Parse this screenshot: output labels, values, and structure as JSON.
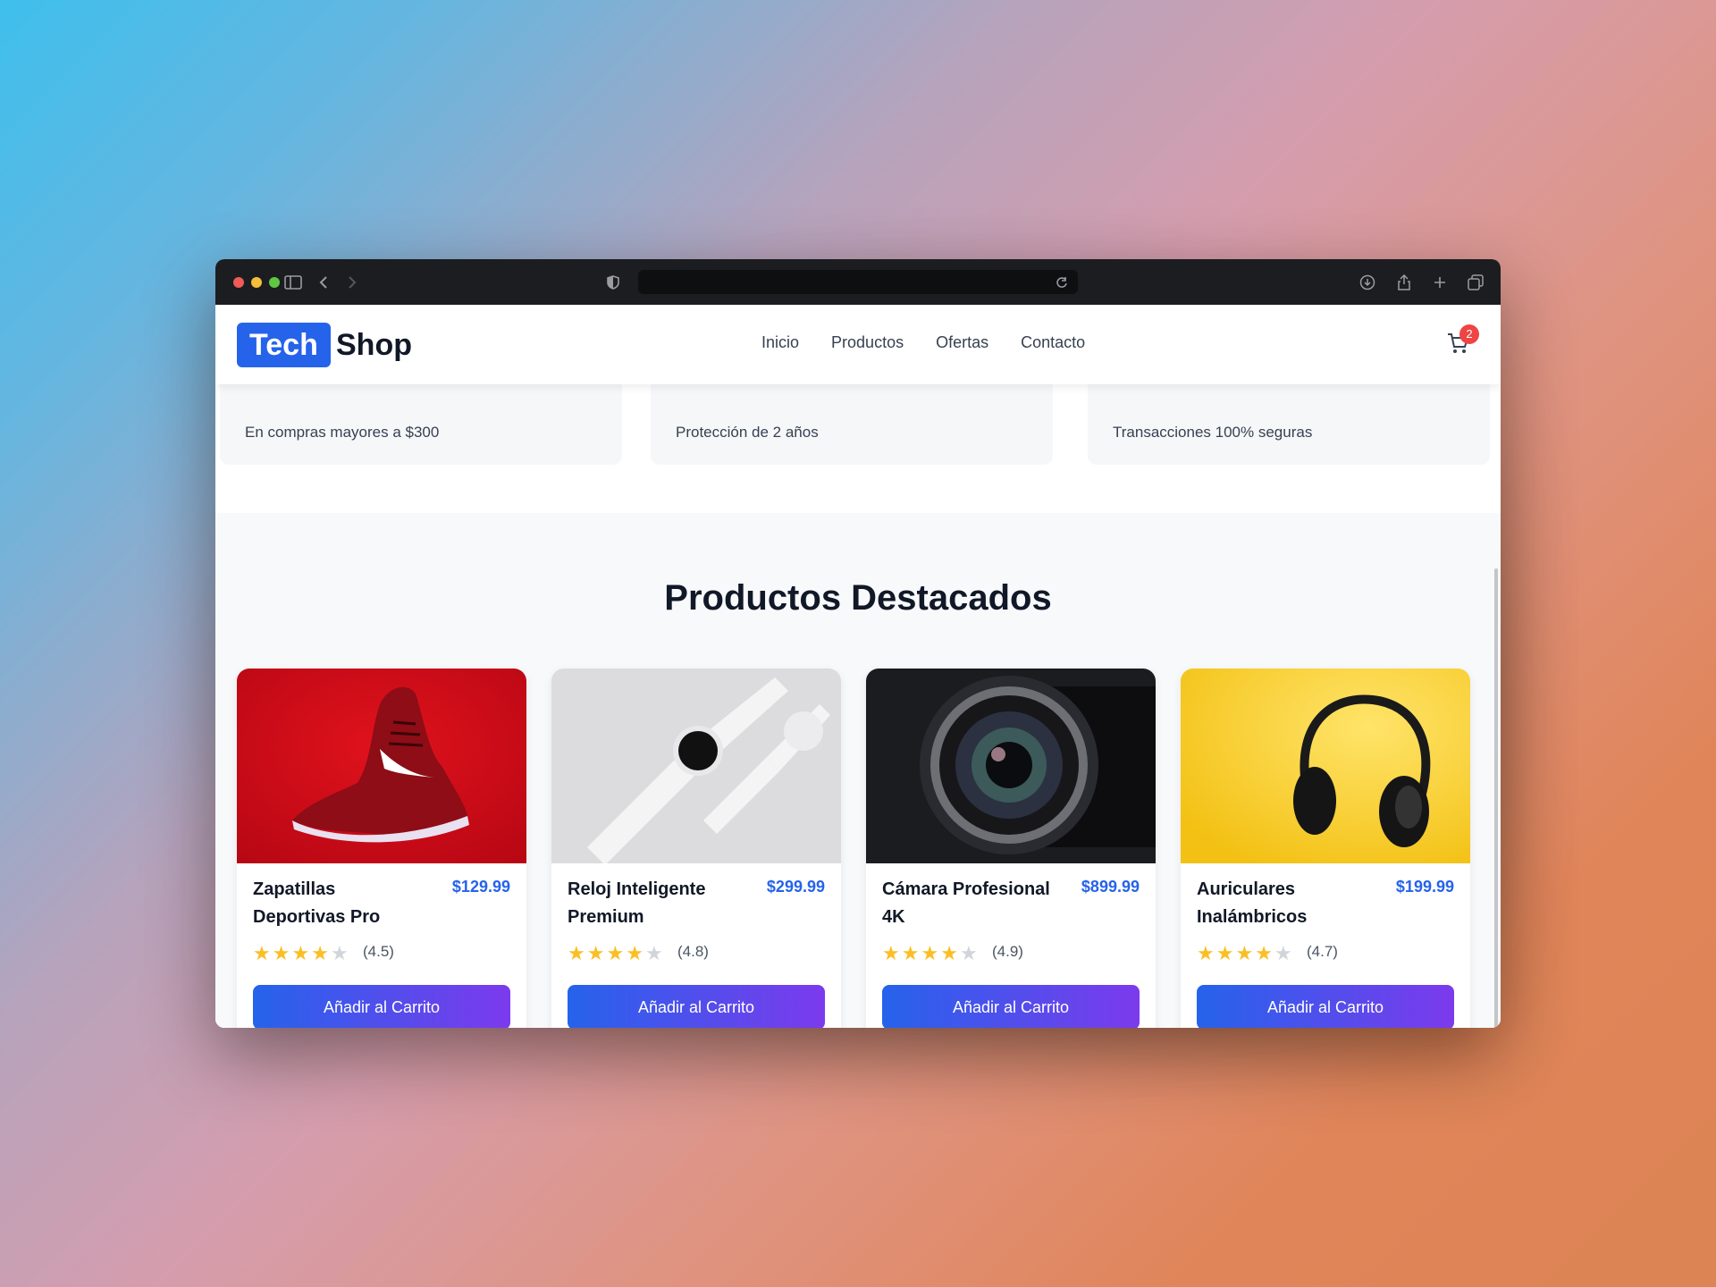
{
  "browser": {
    "address": "",
    "colors": {
      "chrome": "#1c1d20",
      "close": "#ee5c55",
      "minimize": "#f4bd3a",
      "zoom": "#5dc742"
    }
  },
  "nav": {
    "logo_tech": "Tech",
    "logo_shop": "Shop",
    "links": [
      "Inicio",
      "Productos",
      "Ofertas",
      "Contacto"
    ],
    "cart_count": "2"
  },
  "features": [
    {
      "text": "En compras mayores a $300"
    },
    {
      "text": "Protección de 2 años"
    },
    {
      "text": "Transacciones 100% seguras"
    }
  ],
  "section_title": "Productos Destacados",
  "products": [
    {
      "name": "Zapatillas Deportivas Pro",
      "price": "$129.99",
      "rating_text": "(4.5)",
      "stars": 4,
      "button": "Añadir al Carrito",
      "image": "red sneaker"
    },
    {
      "name": "Reloj Inteligente Premium",
      "price": "$299.99",
      "rating_text": "(4.8)",
      "stars": 4,
      "button": "Añadir al Carrito",
      "image": "white smartwatch"
    },
    {
      "name": "Cámara Profesional 4K",
      "price": "$899.99",
      "rating_text": "(4.9)",
      "stars": 4,
      "button": "Añadir al Carrito",
      "image": "camera lens"
    },
    {
      "name": "Auriculares Inalámbricos",
      "price": "$199.99",
      "rating_text": "(4.7)",
      "stars": 4,
      "button": "Añadir al Carrito",
      "image": "black headphones"
    }
  ],
  "colors": {
    "brand": "#2563eb",
    "button_gradient_end": "#7c3aed",
    "star": "#fbbf24",
    "badge": "#ef4444"
  }
}
